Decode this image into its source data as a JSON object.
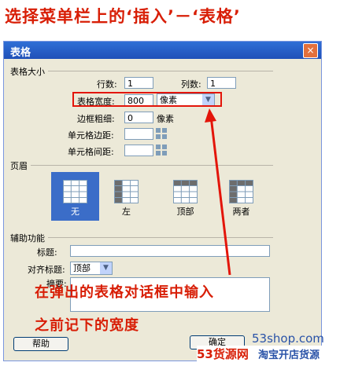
{
  "banner": {
    "title": "选择菜单栏上的‘插入’－‘表格’"
  },
  "dialog": {
    "title": "表格",
    "close_glyph": "×",
    "table_size": {
      "group_label": "表格大小",
      "rows_label": "行数:",
      "rows_value": "1",
      "cols_label": "列数:",
      "cols_value": "1",
      "width_label": "表格宽度:",
      "width_value": "800",
      "width_unit": "像素",
      "border_label": "边框粗细:",
      "border_value": "0",
      "border_unit": "像素",
      "padding_label": "单元格边距:",
      "padding_value": "",
      "spacing_label": "单元格间距:",
      "spacing_value": ""
    },
    "header": {
      "group_label": "页眉",
      "options": [
        {
          "label": "无"
        },
        {
          "label": "左"
        },
        {
          "label": "顶部"
        },
        {
          "label": "两者"
        }
      ],
      "selected": "无"
    },
    "accessibility": {
      "group_label": "辅助功能",
      "caption_label": "标题:",
      "caption_value": "",
      "align_label": "对齐标题:",
      "align_value": "顶部",
      "summary_label": "摘要:"
    },
    "buttons": {
      "help": "帮助",
      "ok": "确定"
    }
  },
  "annotation": {
    "line1": "在弹出的表格对话框中输入",
    "line2": "之前记下的宽度"
  },
  "watermark": {
    "site": "53shop.com",
    "brand": "53货源网",
    "brand_sub": "淘宝开店货源"
  },
  "colors": {
    "accent_red": "#d81e06",
    "title_blue": "#1f50b8",
    "selected_header": "#3b6dc8"
  }
}
